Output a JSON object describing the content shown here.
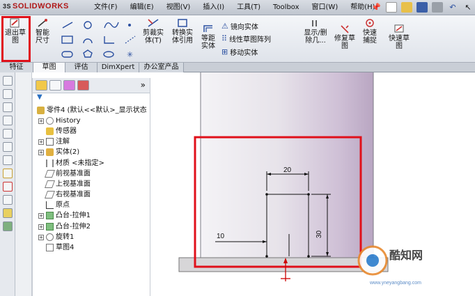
{
  "app": {
    "logo": "SOLIDWORKS",
    "logo_prefix": "3S"
  },
  "menu": [
    "文件(F)",
    "编辑(E)",
    "视图(V)",
    "插入(I)",
    "工具(T)",
    "Toolbox",
    "窗口(W)",
    "帮助(H)"
  ],
  "ribbon": {
    "exit_sketch": "退出草图",
    "smart_dim": "智能尺寸",
    "trim": "剪裁实体(T)",
    "convert": "转换实体引用",
    "offset": "等距实体",
    "mirror": "镜向实体",
    "linear_pattern": "线性草图阵列",
    "move": "移动实体",
    "show_delete": "显示/删除几...",
    "repair": "修复草图",
    "quick_snap": "快速捕捉",
    "rapid_sketch": "快速草图"
  },
  "tabs": [
    "特征",
    "草图",
    "评估",
    "DimXpert",
    "办公室产品"
  ],
  "tree": {
    "root": "零件4 (默认<<默认>_显示状态",
    "items": [
      "History",
      "传感器",
      "注解",
      "实体(2)",
      "材质 <未指定>",
      "前视基准面",
      "上视基准面",
      "右视基准面",
      "原点",
      "凸台-拉伸1",
      "凸台-拉伸2",
      "旋转1",
      "草图4"
    ],
    "collapse": "»"
  },
  "canvas": {
    "dim_top": "20",
    "dim_right": "30",
    "dim_left": "10"
  },
  "watermark": {
    "brand": "酷知网",
    "url": "www.yneyangbang.com"
  },
  "colors": {
    "highlight": "#e0101a",
    "accent": "#b01818"
  }
}
